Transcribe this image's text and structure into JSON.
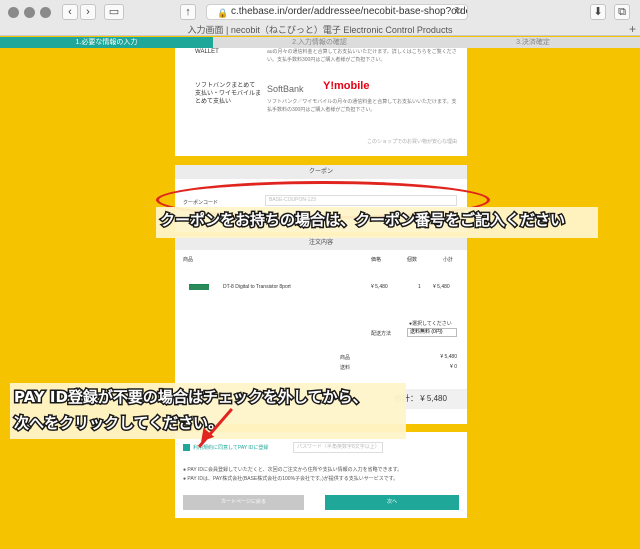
{
  "browser": {
    "url": "c.thebase.in/order/addressee/necobit-base-shop?order=gueo",
    "tab_title": "入力画面 | necobit（ねこびっと）電子 Electronic Control Products",
    "back_icon": "chevron-left-icon",
    "forward_icon": "chevron-right-icon"
  },
  "steps": [
    "1.必要な情報の入力",
    "2.入力情報の確認",
    "3.決済確定"
  ],
  "payment": {
    "wallet_label": "WALLET",
    "wallet_desc": "auの月々の通信料金と合算してお支払いいただけます。詳しくはこちらをご覧ください。支払手数料300円はご購入者様がご負担下さい。",
    "softbank_label": "ソフトバンクまとめて支払い・ワイモバイルまとめて支払い",
    "softbank_logo": "SoftBank",
    "ymobile_logo": "Y!mobile",
    "softbank_desc": "ソフトバンク／ワイモバイルの月々の通信料金と合算してお支払いいただけます。支払手数料の300円はご購入者様がご負担下さい。",
    "link": "このショップでのお買い物が安心な理由"
  },
  "coupon": {
    "heading": "クーポン",
    "label": "クーポンコード",
    "placeholder": "BASE-COUPON-123"
  },
  "annotation1": "クーポンをお持ちの場合は、クーポン番号をご記入ください",
  "order": {
    "heading": "注文内容",
    "col_item": "商品",
    "col_price": "価格",
    "col_qty": "個数",
    "col_subtotal": "小計",
    "item_name": "DT-8 Digital to Transistor 8port",
    "item_price": "¥ 5,480",
    "item_qty": "1",
    "item_subtotal": "¥ 5,480",
    "ship_note": "●選択してください",
    "ship_label": "配送方法",
    "ship_value": "送料無料 (0円)",
    "sum_label": "商品",
    "sum_value": "¥ 5,480",
    "shipping_label": "送料",
    "shipping_value": "¥ 0",
    "total_label": "合計：",
    "total_value": "¥ 5,480"
  },
  "annotation2": [
    "PAY ID登録が不要の場合はチェックを外してから、",
    "次へをクリックしてください。"
  ],
  "bottom": {
    "checkbox_label": "利用規約に同意してPAY IDに登録",
    "password_placeholder": "パスワード（半角英数字8文字以上）",
    "note1": "● PAY IDに会員登録していただくと、次回のご注文から住所や支払い情報の入力を省略できます。",
    "note2": "● PAY IDは、PAY株式会社(BASE株式会社の100%子会社です。)が提供する支払いサービスです。",
    "back_button": "カートページに戻る",
    "next_button": "次へ"
  }
}
